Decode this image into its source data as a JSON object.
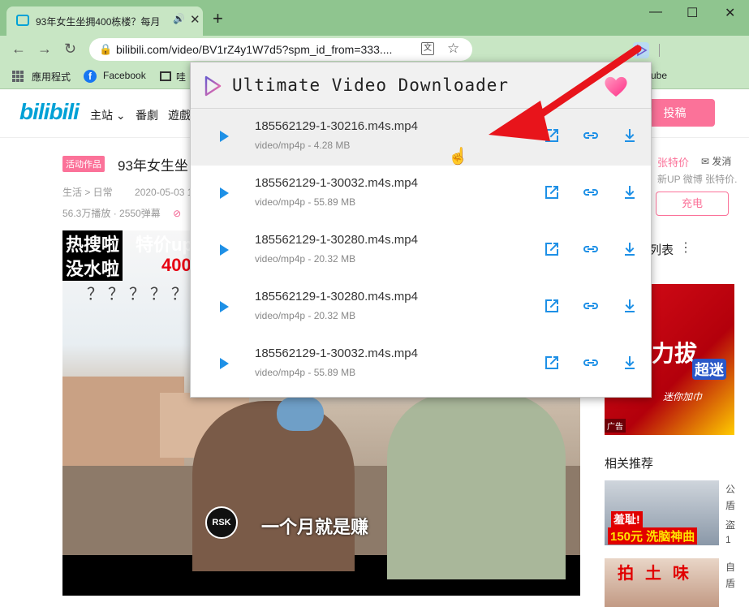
{
  "browser": {
    "tab_title": "93年女生坐拥400栋楼？每月",
    "new_tab": "+",
    "window_controls": {
      "minimize": "—",
      "maximize": "☐",
      "close": "✕"
    },
    "url": "bilibili.com/video/BV1rZ4y1W7d5?spm_id_from=333....",
    "bookmarks": [
      {
        "label": "應用程式"
      },
      {
        "label": "Facebook"
      },
      {
        "label": "哇"
      },
      {
        "label": "ube"
      }
    ]
  },
  "site": {
    "logo": "bilibili",
    "nav": [
      "主站",
      "番劇",
      "遊戲"
    ],
    "submit_label": "投稿",
    "video": {
      "badge": "活动作品",
      "title": "93年女生坐",
      "category": "生活 > 日常",
      "date": "2020-05-03 11:",
      "stats": "56.3万播放 · 2550弹幕",
      "caption_top_left_1": "热搜啦",
      "caption_top_right_1": "特价up",
      "caption_top_left_2": "没水啦",
      "caption_top_right_2": "400",
      "caption_questions": "？？？？？？",
      "channel_logo": "RSK",
      "caption_bottom": "一个月就是赚"
    },
    "sidebar": {
      "up_name": "张特价",
      "message": "发消",
      "up_desc": "新UP 微博 张特价.",
      "charge": "充电",
      "list_title": "列表",
      "list_more": "⋮",
      "ad_text_1": "力拔",
      "ad_text_2": "超迷",
      "ad_text_3": "迷你加巾",
      "ad_tag": "广告",
      "related_title": "相关推荐",
      "rel1_cap1": "羞耻!",
      "rel1_cap2": "150元 洗脑神曲",
      "rel1_side": [
        "公",
        "盾",
        "盗",
        "1"
      ],
      "rel2_cap": "拍土味",
      "rel2_side": [
        "自",
        "盾"
      ]
    }
  },
  "popup": {
    "title": "Ultimate Video Downloader",
    "items": [
      {
        "name": "185562129-1-30216.m4s.mp4",
        "meta": "video/mp4p - 4.28 MB"
      },
      {
        "name": "185562129-1-30032.m4s.mp4",
        "meta": "video/mp4p - 55.89 MB"
      },
      {
        "name": "185562129-1-30280.m4s.mp4",
        "meta": "video/mp4p - 20.32 MB"
      },
      {
        "name": "185562129-1-30280.m4s.mp4",
        "meta": "video/mp4p - 20.32 MB"
      },
      {
        "name": "185562129-1-30032.m4s.mp4",
        "meta": "video/mp4p - 55.89 MB"
      }
    ]
  },
  "colors": {
    "accent": "#1e90e6",
    "bili_pink": "#fb7299",
    "chrome_green": "#c8e6c4",
    "arrow_red": "#e8141b"
  }
}
